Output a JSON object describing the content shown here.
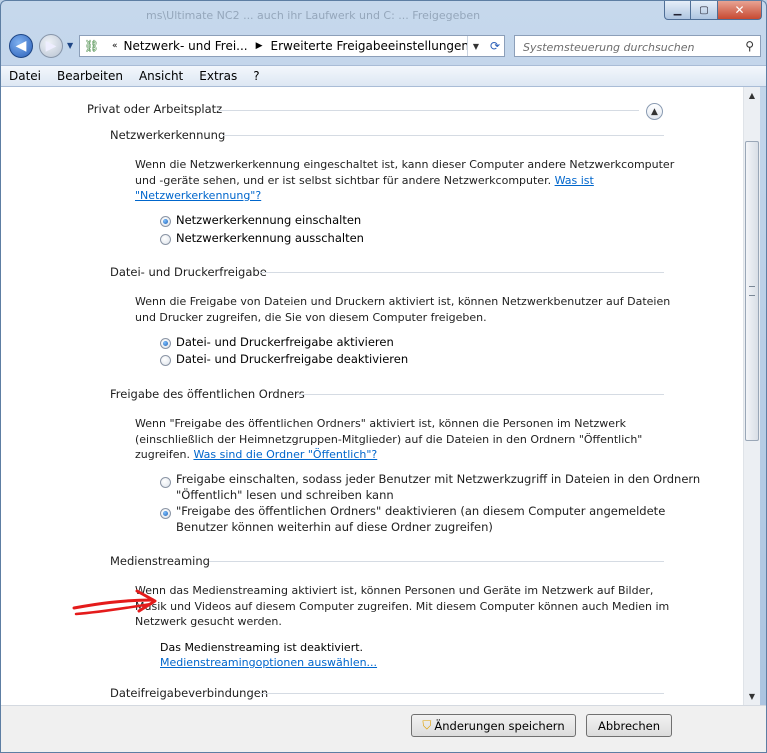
{
  "window": {
    "blurred_title": "ms\\Ultimate NC2 ... auch ihr Laufwerk und C: ... Freigegeben",
    "minimize": "▁",
    "maximize": "▢",
    "close": "✕"
  },
  "nav": {
    "address_overflow": "«",
    "breadcrumb": [
      "Netzwerk- und Frei...",
      "Erweiterte Freigabeeinstellungen"
    ],
    "search_placeholder": "Systemsteuerung durchsuchen"
  },
  "menu": [
    {
      "label": "Datei"
    },
    {
      "label": "Bearbeiten"
    },
    {
      "label": "Ansicht"
    },
    {
      "label": "Extras"
    },
    {
      "label": "?"
    }
  ],
  "profile": {
    "title": "Privat oder Arbeitsplatz"
  },
  "sections": {
    "discovery": {
      "heading": "Netzwerkerkennung",
      "text_1": "Wenn die Netzwerkerkennung eingeschaltet ist, kann dieser Computer andere Netzwerkcomputer",
      "text_2": "und -geräte sehen, und er ist selbst sichtbar für andere Netzwerkcomputer.",
      "link_1": "Was ist",
      "link_2": "\"Netzwerkerkennung\"?",
      "option_on": "Netzwerkerkennung einschalten",
      "option_off": "Netzwerkerkennung ausschalten",
      "selected": "on"
    },
    "file_sharing": {
      "heading": "Datei- und Druckerfreigabe",
      "text_1": "Wenn die Freigabe von Dateien und Druckern aktiviert ist, können Netzwerkbenutzer auf Dateien",
      "text_2": "und Drucker zugreifen, die Sie von diesem Computer freigeben.",
      "option_on": "Datei- und Druckerfreigabe aktivieren",
      "option_off": "Datei- und Druckerfreigabe deaktivieren",
      "selected": "on"
    },
    "public_folder": {
      "heading": "Freigabe des öffentlichen Ordners",
      "text_1": "Wenn \"Freigabe des öffentlichen Ordners\" aktiviert ist, können die Personen im Netzwerk",
      "text_2": "(einschließlich der Heimnetzgruppen-Mitglieder) auf die Dateien in den Ordnern \"Öffentlich\"",
      "text_3": "zugreifen.",
      "link": "Was sind die Ordner \"Öffentlich\"?",
      "option_on_1": "Freigabe einschalten, sodass jeder Benutzer mit Netzwerkzugriff in Dateien in den Ordnern",
      "option_on_2": "\"Öffentlich\" lesen und schreiben kann",
      "option_off_1": "\"Freigabe des öffentlichen Ordners\" deaktivieren (an diesem Computer angemeldete",
      "option_off_2": "Benutzer können weiterhin auf diese Ordner zugreifen)",
      "selected": "off"
    },
    "media": {
      "heading": "Medienstreaming",
      "text_1": "Wenn das Medienstreaming aktiviert ist, können Personen und Geräte im Netzwerk auf Bilder,",
      "text_2": "Musik und Videos auf diesem Computer zugreifen. Mit diesem Computer können auch Medien im",
      "text_3": "Netzwerk gesucht werden.",
      "status": "Das Medienstreaming ist deaktiviert.",
      "link": "Medienstreamingoptionen auswählen..."
    },
    "connections": {
      "heading": "Dateifreigabeverbindungen"
    }
  },
  "footer": {
    "save": "Änderungen speichern",
    "cancel": "Abbrechen"
  },
  "colors": {
    "link": "#0066cc",
    "annotation_arrow": "#e41b1b"
  }
}
